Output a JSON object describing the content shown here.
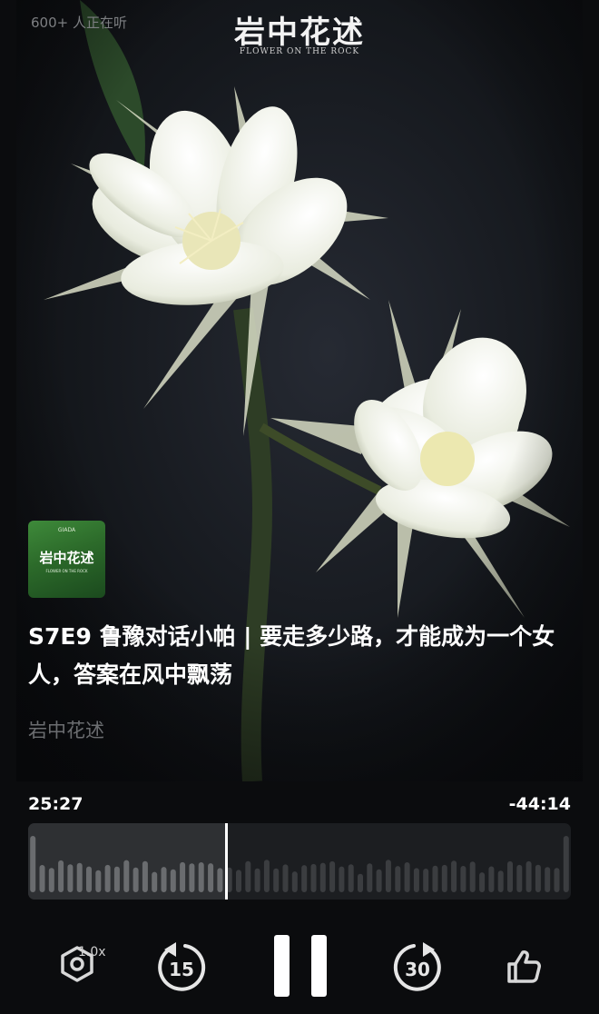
{
  "header": {
    "listeners": "600+ 人正在听",
    "brand_cn": "岩中花述",
    "brand_en": "FLOWER ON THE ROCK"
  },
  "album": {
    "thumb_small": "GIADA",
    "thumb_cn": "岩中花述",
    "thumb_en": "FLOWER ON THE ROCK"
  },
  "episode": {
    "title": "S7E9 鲁豫对话小帕 | 要走多少路，才能成为一个女人，答案在风中飘荡",
    "author": "岩中花述"
  },
  "player": {
    "current_time": "25:27",
    "remaining_time": "-44:14",
    "progress": 0.365,
    "speed": "1.0x",
    "rewind_seconds": "15",
    "forward_seconds": "30"
  },
  "colors": {
    "background": "#0b0c0e",
    "played_wave": "#2e3033",
    "bar_color": "#5a5c5f",
    "playhead": "#ffffff"
  }
}
